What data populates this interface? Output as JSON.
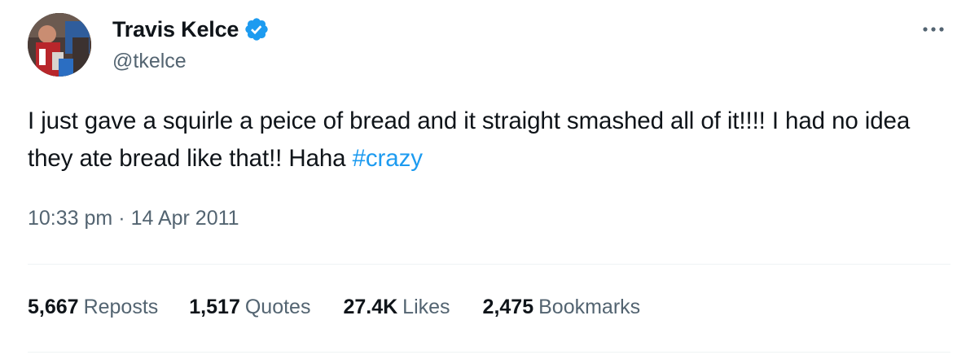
{
  "author": {
    "display_name": "Travis Kelce",
    "handle": "@tkelce",
    "verified_color": "#1d9bf0"
  },
  "tweet": {
    "text_before": "I just gave a squirle a peice of bread and it straight smashed all of it!!!! I had no idea they ate bread like that!! Haha ",
    "hashtag": "#crazy",
    "time": "10:33 pm",
    "separator": "·",
    "date": "14 Apr 2011"
  },
  "stats": {
    "reposts": {
      "count": "5,667",
      "label": "Reposts"
    },
    "quotes": {
      "count": "1,517",
      "label": "Quotes"
    },
    "likes": {
      "count": "27.4K",
      "label": "Likes"
    },
    "bookmarks": {
      "count": "2,475",
      "label": "Bookmarks"
    }
  },
  "icons": {
    "verified": "verified-badge-icon",
    "more": "more-options-icon"
  },
  "colors": {
    "link": "#1d9bf0",
    "secondary_text": "#536471",
    "primary_text": "#0f1419",
    "divider": "#eff3f4"
  }
}
